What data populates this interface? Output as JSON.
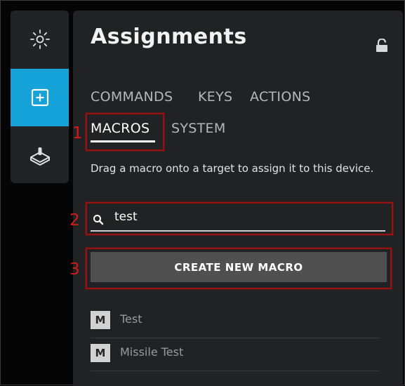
{
  "colors": {
    "accent": "#15a3d9",
    "annotation": "#9b1010",
    "annotation_number": "#d21c1c",
    "panel": "#212223",
    "button": "#505050"
  },
  "rail": {
    "items": [
      {
        "icon": "sun-icon",
        "active": false
      },
      {
        "icon": "add-square-icon",
        "active": true
      },
      {
        "icon": "joystick-icon",
        "active": false
      }
    ]
  },
  "panel": {
    "title": "Assignments",
    "lock_icon": "lock-icon",
    "tabs": [
      "COMMANDS",
      "KEYS",
      "ACTIONS",
      "MACROS",
      "SYSTEM"
    ],
    "active_tab": "MACROS",
    "description": "Drag a macro onto a target to assign it to this device.",
    "search": {
      "value": "test",
      "icon": "search-icon"
    },
    "create_button": "CREATE NEW MACRO",
    "macros": [
      {
        "badge": "M",
        "name": "Test"
      },
      {
        "badge": "M",
        "name": "Missile Test"
      }
    ]
  },
  "annotations": [
    "1",
    "2",
    "3"
  ]
}
